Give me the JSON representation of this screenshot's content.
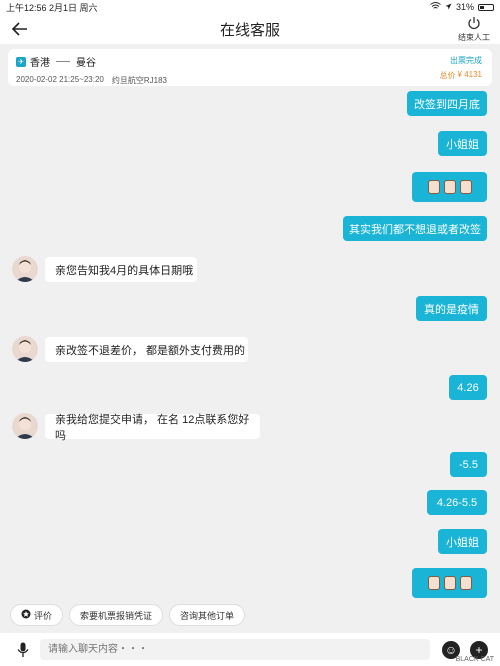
{
  "statusbar": {
    "time": "上午12:56",
    "date": "2月1日 周六",
    "battery": "31%"
  },
  "navbar": {
    "title": "在线客服",
    "end_label": "结束人工"
  },
  "order": {
    "from": "香港",
    "to": "曼谷",
    "datetime": "2020-02-02 21:25~23:20",
    "flight": "约旦航空RJ183",
    "status": "出票完成",
    "price_label": "总价",
    "price": "¥ 4131"
  },
  "messages": [
    {
      "side": "out",
      "text": "改签到四月底"
    },
    {
      "side": "out",
      "text": "小姐姐"
    },
    {
      "side": "out",
      "text": ""
    },
    {
      "side": "out",
      "text": "其实我们都不想退或者改签"
    },
    {
      "side": "in",
      "text": "亲您告知我4月的具体日期哦"
    },
    {
      "side": "out",
      "text": "真的是疫情"
    },
    {
      "side": "in",
      "text": "亲改签不退差价， 都是额外支付费用的"
    },
    {
      "side": "out",
      "text": "4.26"
    },
    {
      "side": "in",
      "text": "亲我给您提交申请， 在名 12点联系您好吗"
    },
    {
      "side": "out",
      "text": "-5.5"
    },
    {
      "side": "out",
      "text": "4.26-5.5"
    },
    {
      "side": "out",
      "text": "小姐姐"
    },
    {
      "side": "out",
      "text": ""
    }
  ],
  "quick_actions": [
    "评价",
    "索要机票报销凭证",
    "咨询其他订单"
  ],
  "input": {
    "placeholder": "请输入聊天内容・・・"
  },
  "watermark": "BLACK CAT",
  "colors": {
    "accent": "#1ab4d6",
    "price": "#f08a28"
  }
}
